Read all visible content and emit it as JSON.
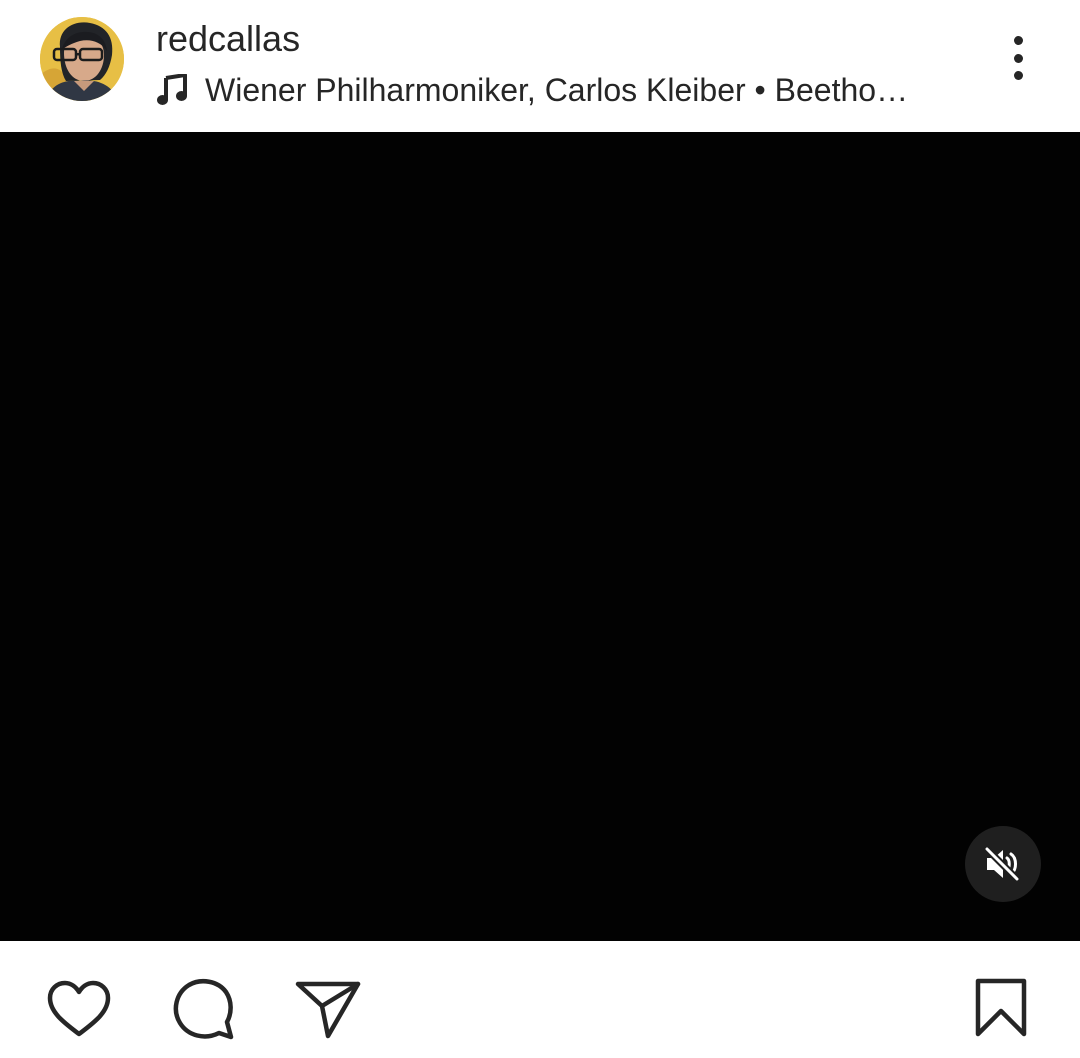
{
  "post": {
    "username": "redcallas",
    "audio": {
      "text": "Wiener Philharmoniker, Carlos Kleiber • Beetho…",
      "icon": "music-note-icon"
    },
    "more_icon": "more-vertical-icon"
  },
  "video": {
    "background_color": "#020202",
    "mute_icon": "volume-muted-icon"
  },
  "actions": {
    "like_icon": "heart-icon",
    "comment_icon": "comment-icon",
    "share_icon": "paper-plane-icon",
    "save_icon": "bookmark-icon"
  },
  "colors": {
    "text": "#262626",
    "background": "#ffffff",
    "mute_button_bg": "#1f1f1f"
  }
}
